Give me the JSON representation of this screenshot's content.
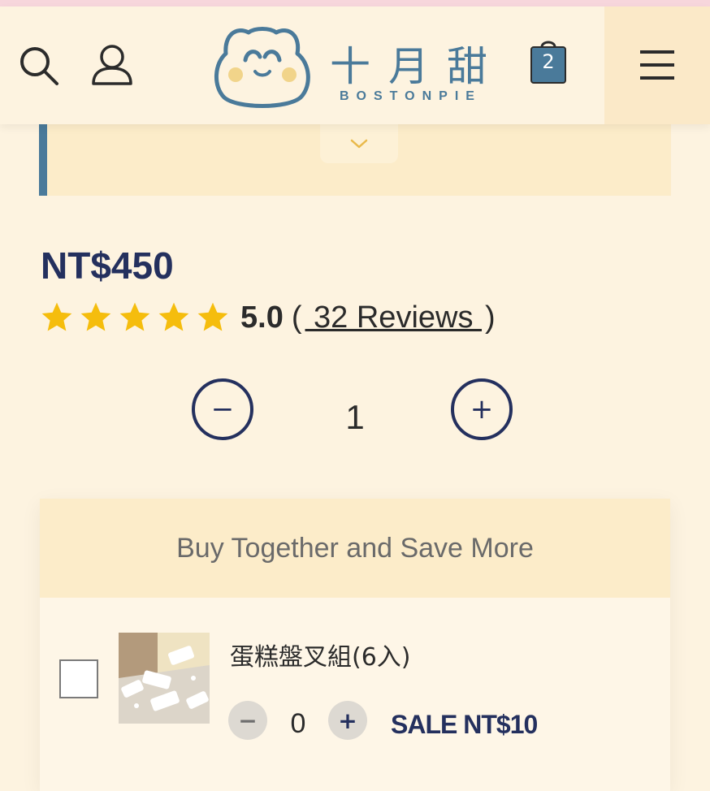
{
  "header": {
    "logo_cn": "十月甜",
    "logo_en": "BOSTONPIE",
    "cart_count": "2",
    "icons": [
      "search-icon",
      "user-icon",
      "cart-icon",
      "hamburger-menu-icon",
      "mascot-logo-icon"
    ]
  },
  "description": {
    "expand_icon": "chevron-down-icon"
  },
  "product": {
    "price": "NT$450",
    "rating_value": "5.0",
    "rating_stars": 5,
    "reviews_open": "(",
    "reviews_text": " 32 Reviews ",
    "reviews_close": ")",
    "quantity": "1",
    "minus_symbol": "−",
    "plus_symbol": "+"
  },
  "bundle": {
    "title": "Buy Together and Save More",
    "items": [
      {
        "name": "蛋糕盤叉組(6入)",
        "quantity": "0",
        "minus_symbol": "−",
        "plus_symbol": "+",
        "sale_price": "SALE NT$10",
        "checked": false
      }
    ]
  },
  "colors": {
    "background": "#fdf3e0",
    "accent_blue": "#4a7a9a",
    "navy": "#24305e",
    "star": "#f5bd0d",
    "panel": "#fcecc9"
  }
}
